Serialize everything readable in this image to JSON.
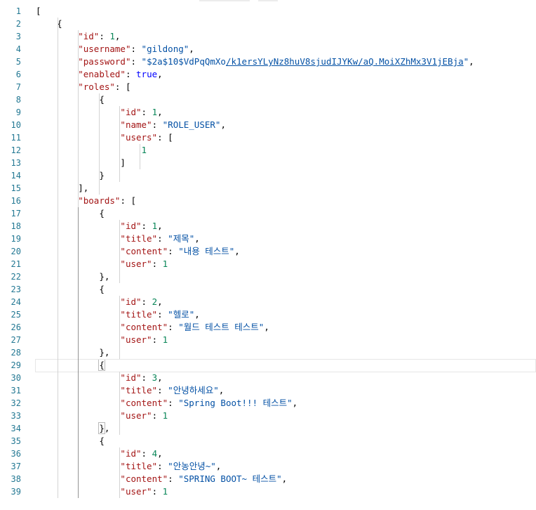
{
  "lines": [
    {
      "n": "1",
      "text": "["
    },
    {
      "n": "2",
      "text": "    {"
    },
    {
      "n": "3",
      "text": "        \"id\": 1,"
    },
    {
      "n": "4",
      "text": "        \"username\": \"gildong\","
    },
    {
      "n": "5",
      "text": "        \"password\": \"$2a$10$VdPqQmXo/k1ersYLyNz8huV8sjudIJYKw/aQ.MoiXZhMx3V1jEBja\","
    },
    {
      "n": "6",
      "text": "        \"enabled\": true,"
    },
    {
      "n": "7",
      "text": "        \"roles\": ["
    },
    {
      "n": "8",
      "text": "            {"
    },
    {
      "n": "9",
      "text": "                \"id\": 1,"
    },
    {
      "n": "10",
      "text": "                \"name\": \"ROLE_USER\","
    },
    {
      "n": "11",
      "text": "                \"users\": ["
    },
    {
      "n": "12",
      "text": "                    1"
    },
    {
      "n": "13",
      "text": "                ]"
    },
    {
      "n": "14",
      "text": "            }"
    },
    {
      "n": "15",
      "text": "        ],"
    },
    {
      "n": "16",
      "text": "        \"boards\": ["
    },
    {
      "n": "17",
      "text": "            {"
    },
    {
      "n": "18",
      "text": "                \"id\": 1,"
    },
    {
      "n": "19",
      "text": "                \"title\": \"제목\","
    },
    {
      "n": "20",
      "text": "                \"content\": \"내용 테스트\","
    },
    {
      "n": "21",
      "text": "                \"user\": 1"
    },
    {
      "n": "22",
      "text": "            },"
    },
    {
      "n": "23",
      "text": "            {"
    },
    {
      "n": "24",
      "text": "                \"id\": 2,"
    },
    {
      "n": "25",
      "text": "                \"title\": \"헬로\","
    },
    {
      "n": "26",
      "text": "                \"content\": \"월드 테스트 테스트\","
    },
    {
      "n": "27",
      "text": "                \"user\": 1"
    },
    {
      "n": "28",
      "text": "            },"
    },
    {
      "n": "29",
      "text": "            {"
    },
    {
      "n": "30",
      "text": "                \"id\": 3,"
    },
    {
      "n": "31",
      "text": "                \"title\": \"안녕하세요\","
    },
    {
      "n": "32",
      "text": "                \"content\": \"Spring Boot!!! 테스트\","
    },
    {
      "n": "33",
      "text": "                \"user\": 1"
    },
    {
      "n": "34",
      "text": "            },"
    },
    {
      "n": "35",
      "text": "            {"
    },
    {
      "n": "36",
      "text": "                \"id\": 4,"
    },
    {
      "n": "37",
      "text": "                \"title\": \"안농안녕~\","
    },
    {
      "n": "38",
      "text": "                \"content\": \"SPRING BOOT~ 테스트\","
    },
    {
      "n": "39",
      "text": "                \"user\": 1"
    }
  ],
  "active_line": "29",
  "colors": {
    "line_number": "#237893",
    "key": "#a31515",
    "string": "#0451a5",
    "number": "#098658",
    "keyword": "#0000ff"
  }
}
